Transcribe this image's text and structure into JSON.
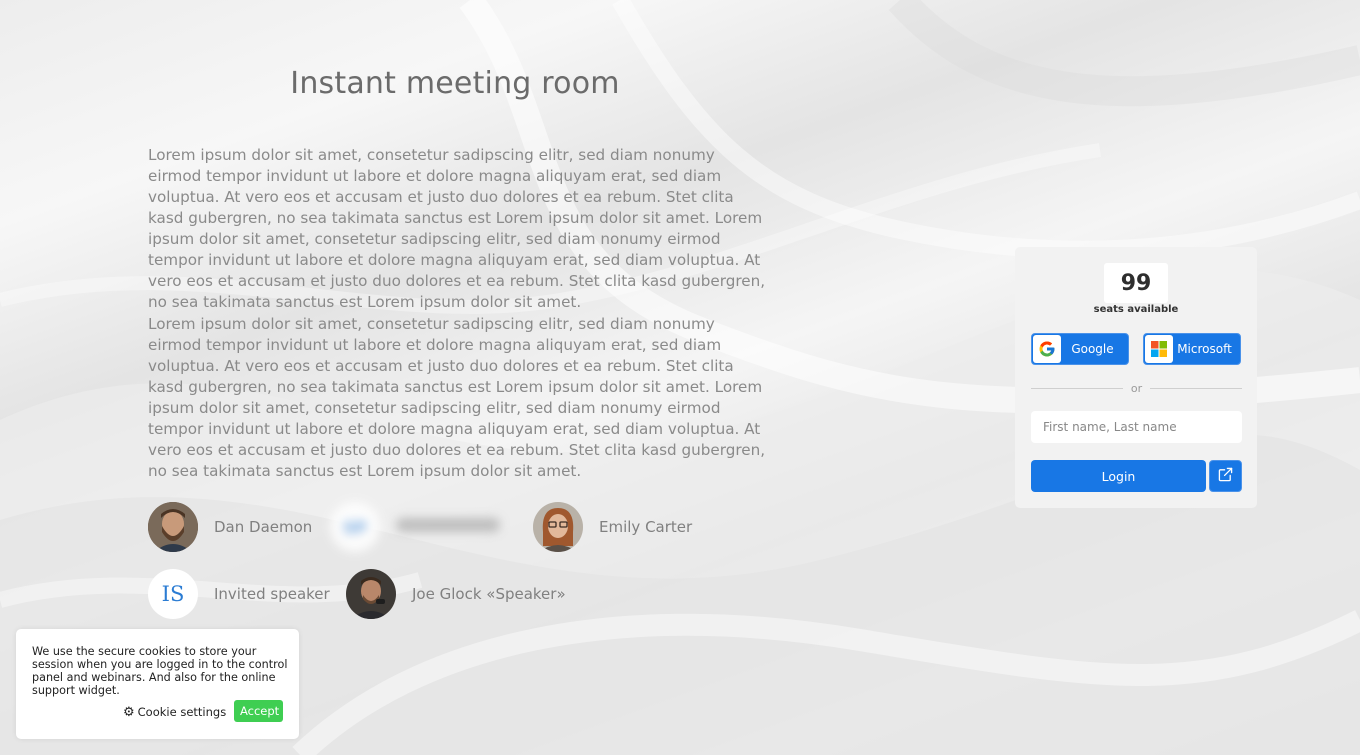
{
  "page": {
    "title": "Instant meeting room",
    "paragraphs": [
      "Lorem ipsum dolor sit amet, consetetur sadipscing elitr, sed diam nonumy eirmod tempor invidunt ut labore et dolore magna aliquyam erat, sed diam voluptua. At vero eos et accusam et justo duo dolores et ea rebum. Stet clita kasd gubergren, no sea takimata sanctus est Lorem ipsum dolor sit amet. Lorem ipsum dolor sit amet, consetetur sadipscing elitr, sed diam nonumy eirmod tempor invidunt ut labore et dolore magna aliquyam erat, sed diam voluptua. At vero eos et accusam et justo duo dolores et ea rebum. Stet clita kasd gubergren, no sea takimata sanctus est Lorem ipsum dolor sit amet.",
      "Lorem ipsum dolor sit amet, consetetur sadipscing elitr, sed diam nonumy eirmod tempor invidunt ut labore et dolore magna aliquyam erat, sed diam voluptua. At vero eos et accusam et justo duo dolores et ea rebum. Stet clita kasd gubergren, no sea takimata sanctus est Lorem ipsum dolor sit amet. Lorem ipsum dolor sit amet, consetetur sadipscing elitr, sed diam nonumy eirmod tempor invidunt ut labore et dolore magna aliquyam erat, sed diam voluptua. At vero eos et accusam et justo duo dolores et ea rebum. Stet clita kasd gubergren, no sea takimata sanctus est Lorem ipsum dolor sit amet."
    ]
  },
  "speakers": [
    {
      "name": "Dan Daemon",
      "avatar": "photo-man-beard"
    },
    {
      "name": "",
      "avatar": "blurred-initials",
      "blurred": true
    },
    {
      "name": "Emily Carter",
      "avatar": "photo-woman-glasses"
    },
    {
      "name": "Invited speaker",
      "initials": "IS"
    },
    {
      "name": "Joe Glock «Speaker»",
      "avatar": "photo-man-speaking"
    }
  ],
  "login_panel": {
    "seats_count": "99",
    "seats_label": "seats available",
    "google_label": "Google",
    "microsoft_label": "Microsoft",
    "or_label": "or",
    "name_placeholder": "First name, Last name",
    "name_value": "",
    "login_label": "Login",
    "external_icon": "external-link-icon"
  },
  "cookie_banner": {
    "text": "We use the secure cookies to store your session when you are logged in to the control panel and webinars. And also for the online support widget.",
    "settings_label": "Cookie settings",
    "settings_icon": "gear-icon",
    "accept_label": "Accept"
  },
  "colors": {
    "primary": "#1877e5",
    "accept": "#3fce52",
    "initials": "#2b7cd3"
  }
}
